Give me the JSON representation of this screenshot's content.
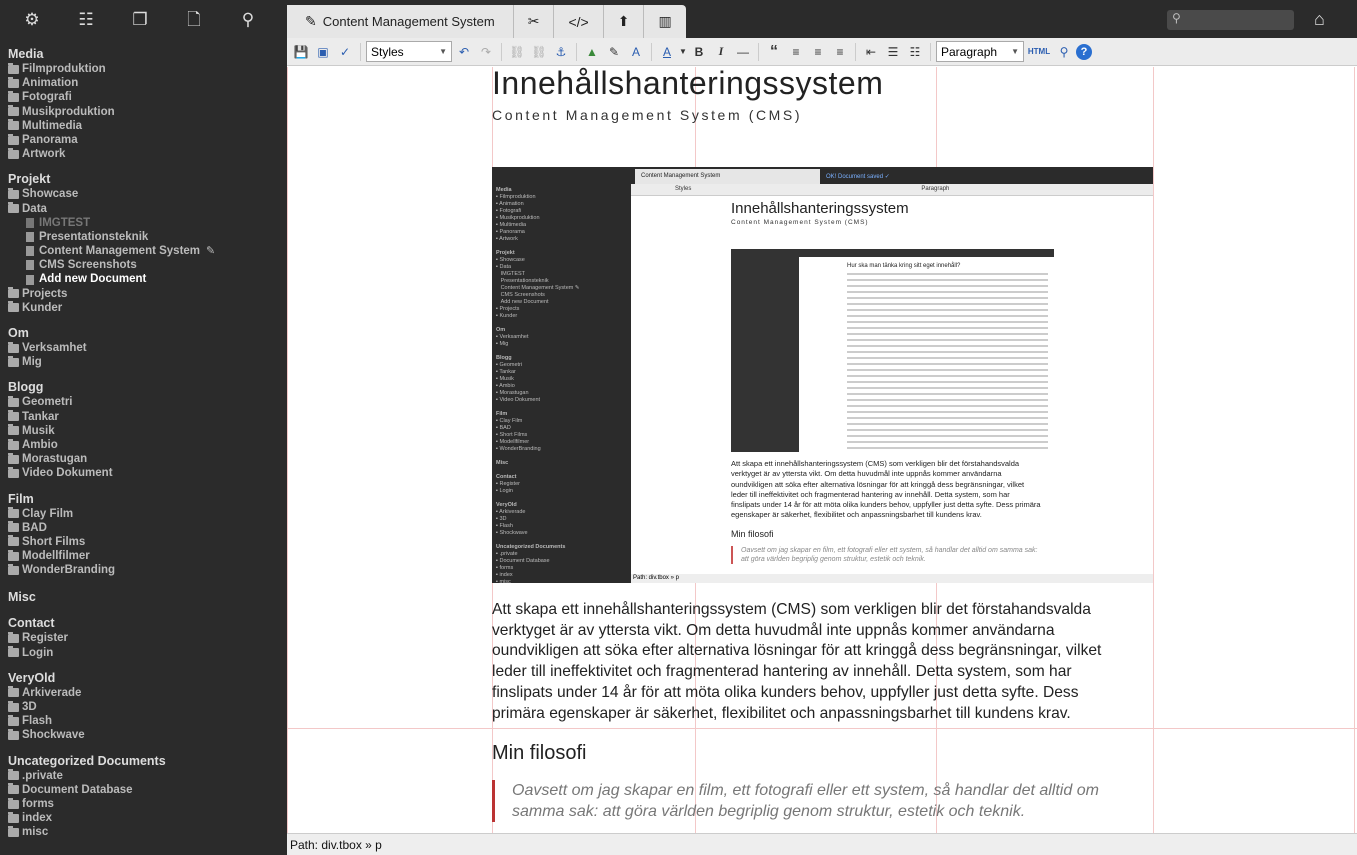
{
  "topbar": {
    "icons": [
      "gear-icon",
      "sitemap-icon",
      "copy-files-icon",
      "new-document-icon",
      "key-search-icon"
    ],
    "tabs": [
      {
        "label": "Content Management System",
        "icon": "pencil-icon"
      },
      {
        "label": "",
        "icon": "magic-wand-icon"
      },
      {
        "label": "",
        "icon": "code-icon"
      },
      {
        "label": "",
        "icon": "upload-icon"
      },
      {
        "label": "",
        "icon": "trash-icon"
      }
    ],
    "search": {
      "value": "",
      "placeholder": ""
    }
  },
  "sidebar": {
    "sections": [
      {
        "title": "Media",
        "items": [
          "Filmproduktion",
          "Animation",
          "Fotografi",
          "Musikproduktion",
          "Multimedia",
          "Panorama",
          "Artwork"
        ]
      },
      {
        "title": "Projekt",
        "items": [
          "Showcase",
          "Data",
          "IMGTEST",
          "Presentationsteknik",
          "Content Management System",
          "CMS Screenshots",
          "Add new Document",
          "Projects",
          "Kunder"
        ]
      },
      {
        "title": "Om",
        "items": [
          "Verksamhet",
          "Mig"
        ]
      },
      {
        "title": "Blogg",
        "items": [
          "Geometri",
          "Tankar",
          "Musik",
          "Ambio",
          "Morastugan",
          "Video Dokument"
        ]
      },
      {
        "title": "Film",
        "items": [
          "Clay Film",
          "BAD",
          "Short Films",
          "Modellfilmer",
          "WonderBranding"
        ]
      },
      {
        "title": "Misc",
        "items": []
      },
      {
        "title": "Contact",
        "items": [
          "Register",
          "Login"
        ]
      },
      {
        "title": "VeryOld",
        "items": [
          "Arkiverade",
          "3D",
          "Flash",
          "Shockwave"
        ]
      },
      {
        "title": "Uncategorized Documents",
        "items": [
          ".private",
          "Document Database",
          "forms",
          "index",
          "misc"
        ]
      }
    ]
  },
  "toolbar": {
    "styles_select": "Styles",
    "format_select": "Paragraph",
    "html_label": "HTML"
  },
  "content": {
    "h1": "Innehållshanteringssystem",
    "subtitle": "Content Management System (CMS)",
    "paragraph": "Att skapa ett innehållshanteringssystem (CMS) som verkligen blir det förstahandsvalda verktyget är av yttersta vikt. Om detta huvudmål inte uppnås kommer användarna oundvikligen att söka efter alternativa lösningar för att kringgå dess begränsningar, vilket leder till ineffektivitet och fragmenterad hantering av innehåll. Detta system, som har finslipats under 14 år för att möta olika kunders behov, uppfyller just detta syfte. Dess primära egenskaper är säkerhet, flexibilitet och anpassningsbarhet till kundens krav.",
    "h2": "Min filosofi",
    "quote": "Oavsett om jag skapar en film, ett fotografi eller ett system, så handlar det alltid om samma sak: att göra världen begriplig genom struktur, estetik och teknik."
  },
  "screenshot": {
    "tab_label": "Content Management System",
    "saved_status": "OK! Document saved ✓",
    "styles": "Styles",
    "format": "Paragraph",
    "path": "Path: div.tbox » p",
    "inner_heading": "Hur ska man tänka kring sitt eget innehåll?"
  },
  "statusbar": {
    "path": "Path: div.tbox » p"
  }
}
